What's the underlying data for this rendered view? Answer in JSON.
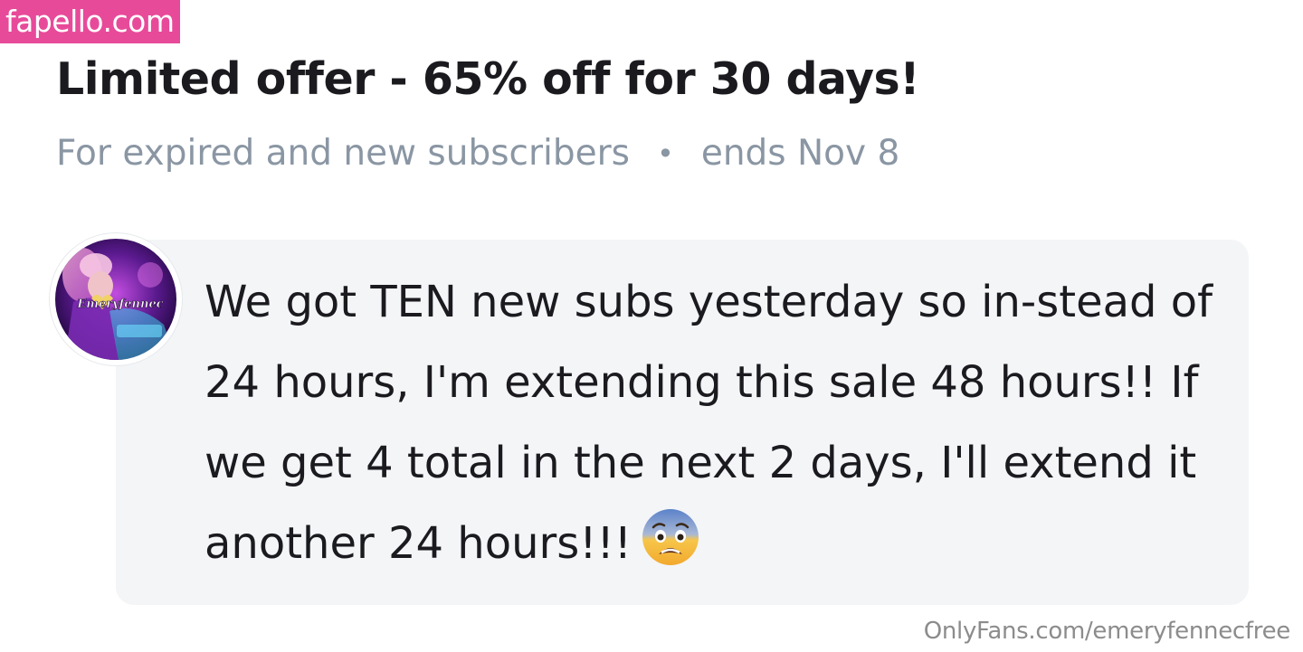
{
  "watermarks": {
    "top": "fapello.com",
    "bottom": "OnlyFans.com/emeryfennecfree"
  },
  "offer": {
    "title": "Limited offer - 65% off for 30 days!",
    "audience": "For expired and new subscribers",
    "separator": "•",
    "ends": "ends Nov 8"
  },
  "message": {
    "avatar_text": "Emeryfennec",
    "text": "We got TEN new subs yesterday so in-stead of 24 hours, I'm extending this sale 48 hours!! If we get 4 total in the next 2 days, I'll extend it another 24 hours!!!",
    "emoji": "fearful-face-emoji"
  },
  "colors": {
    "brand_pink": "#e84a9a",
    "muted_gray": "#8a96a3",
    "bubble_bg": "#f3f5f7",
    "text_dark": "#1b1b1f"
  }
}
